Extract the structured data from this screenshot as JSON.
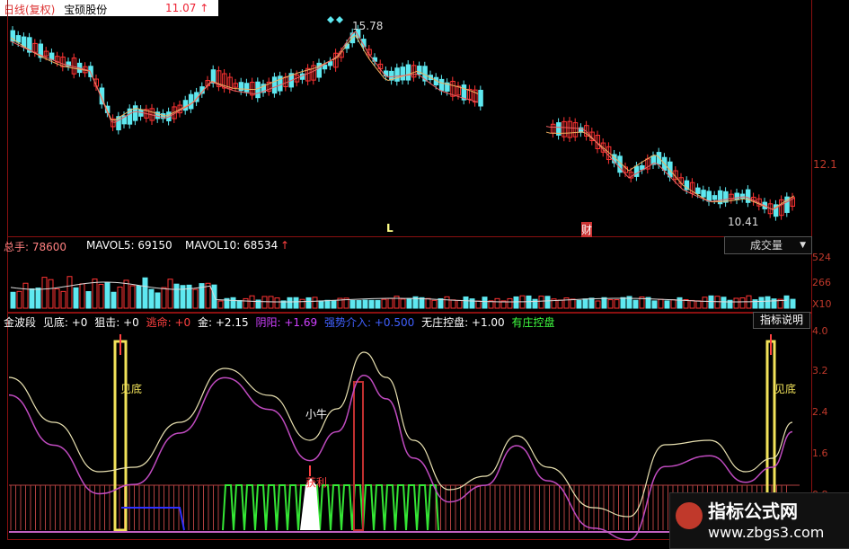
{
  "header": {
    "chart_mode": "日线(复权)",
    "stock_name": "宝硕股份",
    "price": "11.07",
    "price_arrow": "↑"
  },
  "price_panel": {
    "high_label": "15.78",
    "low_label": "10.41",
    "marker_l": "L",
    "marker_cai": "财",
    "right_tick": "12.1"
  },
  "volume_panel": {
    "total_label": "总手: 78600",
    "mavol5_label": "MAVOL5: 69150",
    "mavol10_label": "MAVOL10: 68534",
    "arrow": "↑",
    "dropdown_value": "成交量",
    "ticks": [
      "524",
      "266",
      "X10"
    ]
  },
  "indicator_panel": {
    "name": "金波段",
    "items": [
      {
        "label": "见底: +0",
        "color": "#ffffff"
      },
      {
        "label": "狙击: +0",
        "color": "#ffffff"
      },
      {
        "label": "逃命: +0",
        "color": "#ff4040"
      },
      {
        "label": "金: +2.15",
        "color": "#ffffff"
      },
      {
        "label": "阴阳: +1.69",
        "color": "#d040ff"
      },
      {
        "label": "强势介入: +0.500",
        "color": "#4060ff"
      },
      {
        "label": "无庄控盘: +1.00",
        "color": "#ffffff"
      },
      {
        "label": "有庄控盘",
        "color": "#40ff40"
      }
    ],
    "button_label": "指标说明",
    "annotations": {
      "jiandi_left": "见底",
      "jiandi_right": "见底",
      "xiaoniu": "小牛",
      "huoli": "获利"
    },
    "ticks": [
      "4.0",
      "3.2",
      "2.4",
      "1.6",
      "0.8"
    ]
  },
  "watermark": {
    "title": "指标公式网",
    "url": "www.zbgs3.com"
  },
  "colors": {
    "up": "#ff3333",
    "down": "#5ee8f0",
    "ma1": "#e8e8e8",
    "ma2": "#c04bc0",
    "yellow": "#f2e35a",
    "green": "#35e635",
    "frame": "#8a1010"
  }
}
